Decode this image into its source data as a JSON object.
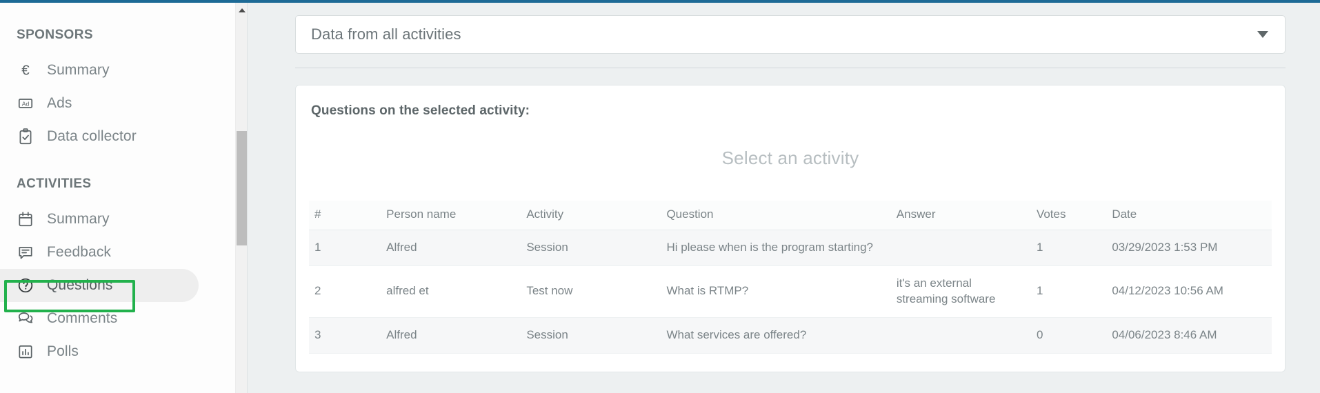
{
  "theme": {
    "accent_bar": "#1d6a96",
    "highlight_box": "#22b14c",
    "link": "#7e9ecb",
    "page_bg": "#edf0f1"
  },
  "sidebar": {
    "groups": [
      {
        "title": "SPONSORS",
        "items": [
          {
            "label": "Summary",
            "icon": "euro-icon",
            "active": false
          },
          {
            "label": "Ads",
            "icon": "ad-badge-icon",
            "active": false
          },
          {
            "label": "Data collector",
            "icon": "clipboard-check-icon",
            "active": false
          }
        ]
      },
      {
        "title": "ACTIVITIES",
        "items": [
          {
            "label": "Summary",
            "icon": "calendar-icon",
            "active": false
          },
          {
            "label": "Feedback",
            "icon": "feedback-bubble-icon",
            "active": false
          },
          {
            "label": "Questions",
            "icon": "question-circle-icon",
            "active": true
          },
          {
            "label": "Comments",
            "icon": "comments-icon",
            "active": false
          },
          {
            "label": "Polls",
            "icon": "bar-chart-icon",
            "active": false
          }
        ]
      }
    ]
  },
  "main": {
    "activity_select": {
      "value": "Data from all activities",
      "caret": "chevron-down-icon"
    },
    "card": {
      "title": "Questions on the selected activity:",
      "empty_note": "Select an activity",
      "table": {
        "columns": [
          "#",
          "Person name",
          "Activity",
          "Question",
          "Answer",
          "Votes",
          "Date"
        ],
        "rows": [
          {
            "num": "1",
            "person": "Alfred",
            "activity": "Session",
            "question": "Hi please when is the program starting?",
            "answer": "",
            "votes": "1",
            "date": "03/29/2023 1:53 PM"
          },
          {
            "num": "2",
            "person": "alfred et",
            "activity": "Test now",
            "question": "What is RTMP?",
            "answer": "it's an external streaming software",
            "votes": "1",
            "date": "04/12/2023 10:56 AM"
          },
          {
            "num": "3",
            "person": "Alfred",
            "activity": "Session",
            "question": "What services are offered?",
            "answer": "",
            "votes": "0",
            "date": "04/06/2023 8:46 AM"
          }
        ]
      }
    }
  }
}
